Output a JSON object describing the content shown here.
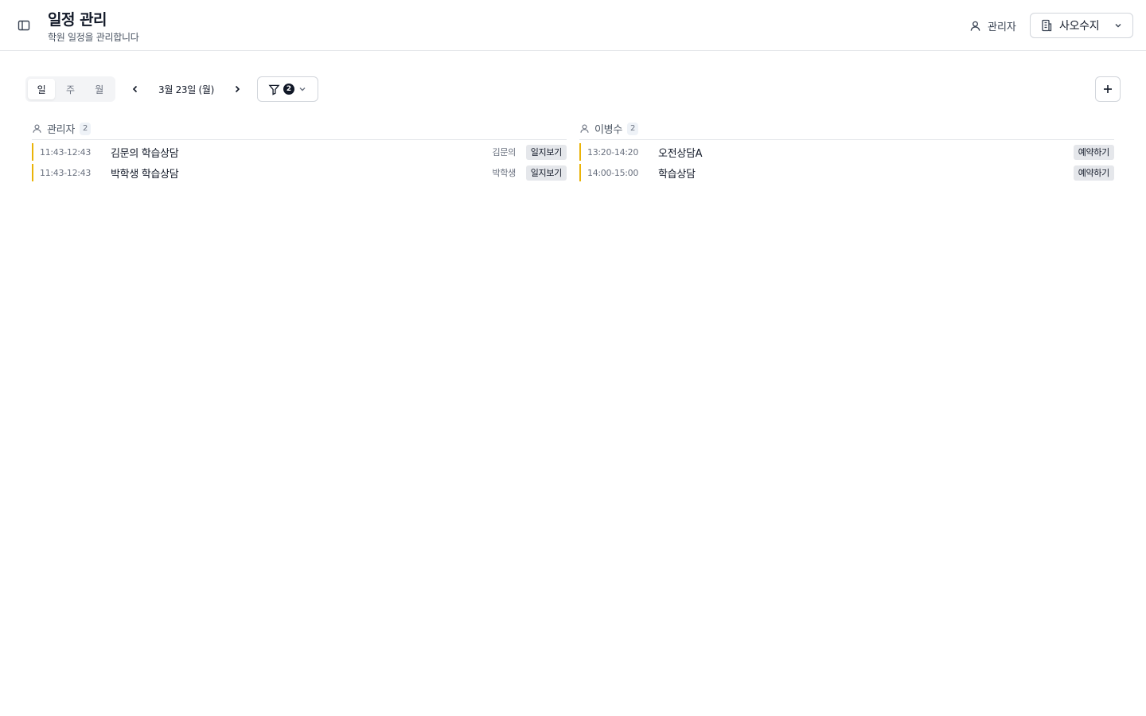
{
  "header": {
    "title": "일정 관리",
    "subtitle": "학원 일정을 관리합니다",
    "user_role": "관리자",
    "branch": "사오수지"
  },
  "toolbar": {
    "views": [
      {
        "label": "일",
        "active": true
      },
      {
        "label": "주",
        "active": false
      },
      {
        "label": "월",
        "active": false
      }
    ],
    "date_label": "3월 23일 (월)",
    "filter_count": "2"
  },
  "columns": [
    {
      "name": "관리자",
      "count": "2",
      "events": [
        {
          "time": "11:43-12:43",
          "title": "김문의 학습상담",
          "student": "김문의",
          "action": "일지보기"
        },
        {
          "time": "11:43-12:43",
          "title": "박학생 학습상담",
          "student": "박학생",
          "action": "일지보기"
        }
      ]
    },
    {
      "name": "이병수",
      "count": "2",
      "events": [
        {
          "time": "13:20-14:20",
          "title": "오전상담A",
          "student": "",
          "action": "예약하기"
        },
        {
          "time": "14:00-15:00",
          "title": "학습상담",
          "student": "",
          "action": "예약하기"
        }
      ]
    }
  ],
  "colors": {
    "accent_bar": "#eab308",
    "text_primary": "#111827",
    "border": "#e5e7eb"
  },
  "icons": [
    "sidebar-toggle-icon",
    "user-icon",
    "building-icon",
    "chevron-down-icon",
    "chevron-left-icon",
    "chevron-right-icon",
    "filter-icon",
    "plus-icon"
  ]
}
